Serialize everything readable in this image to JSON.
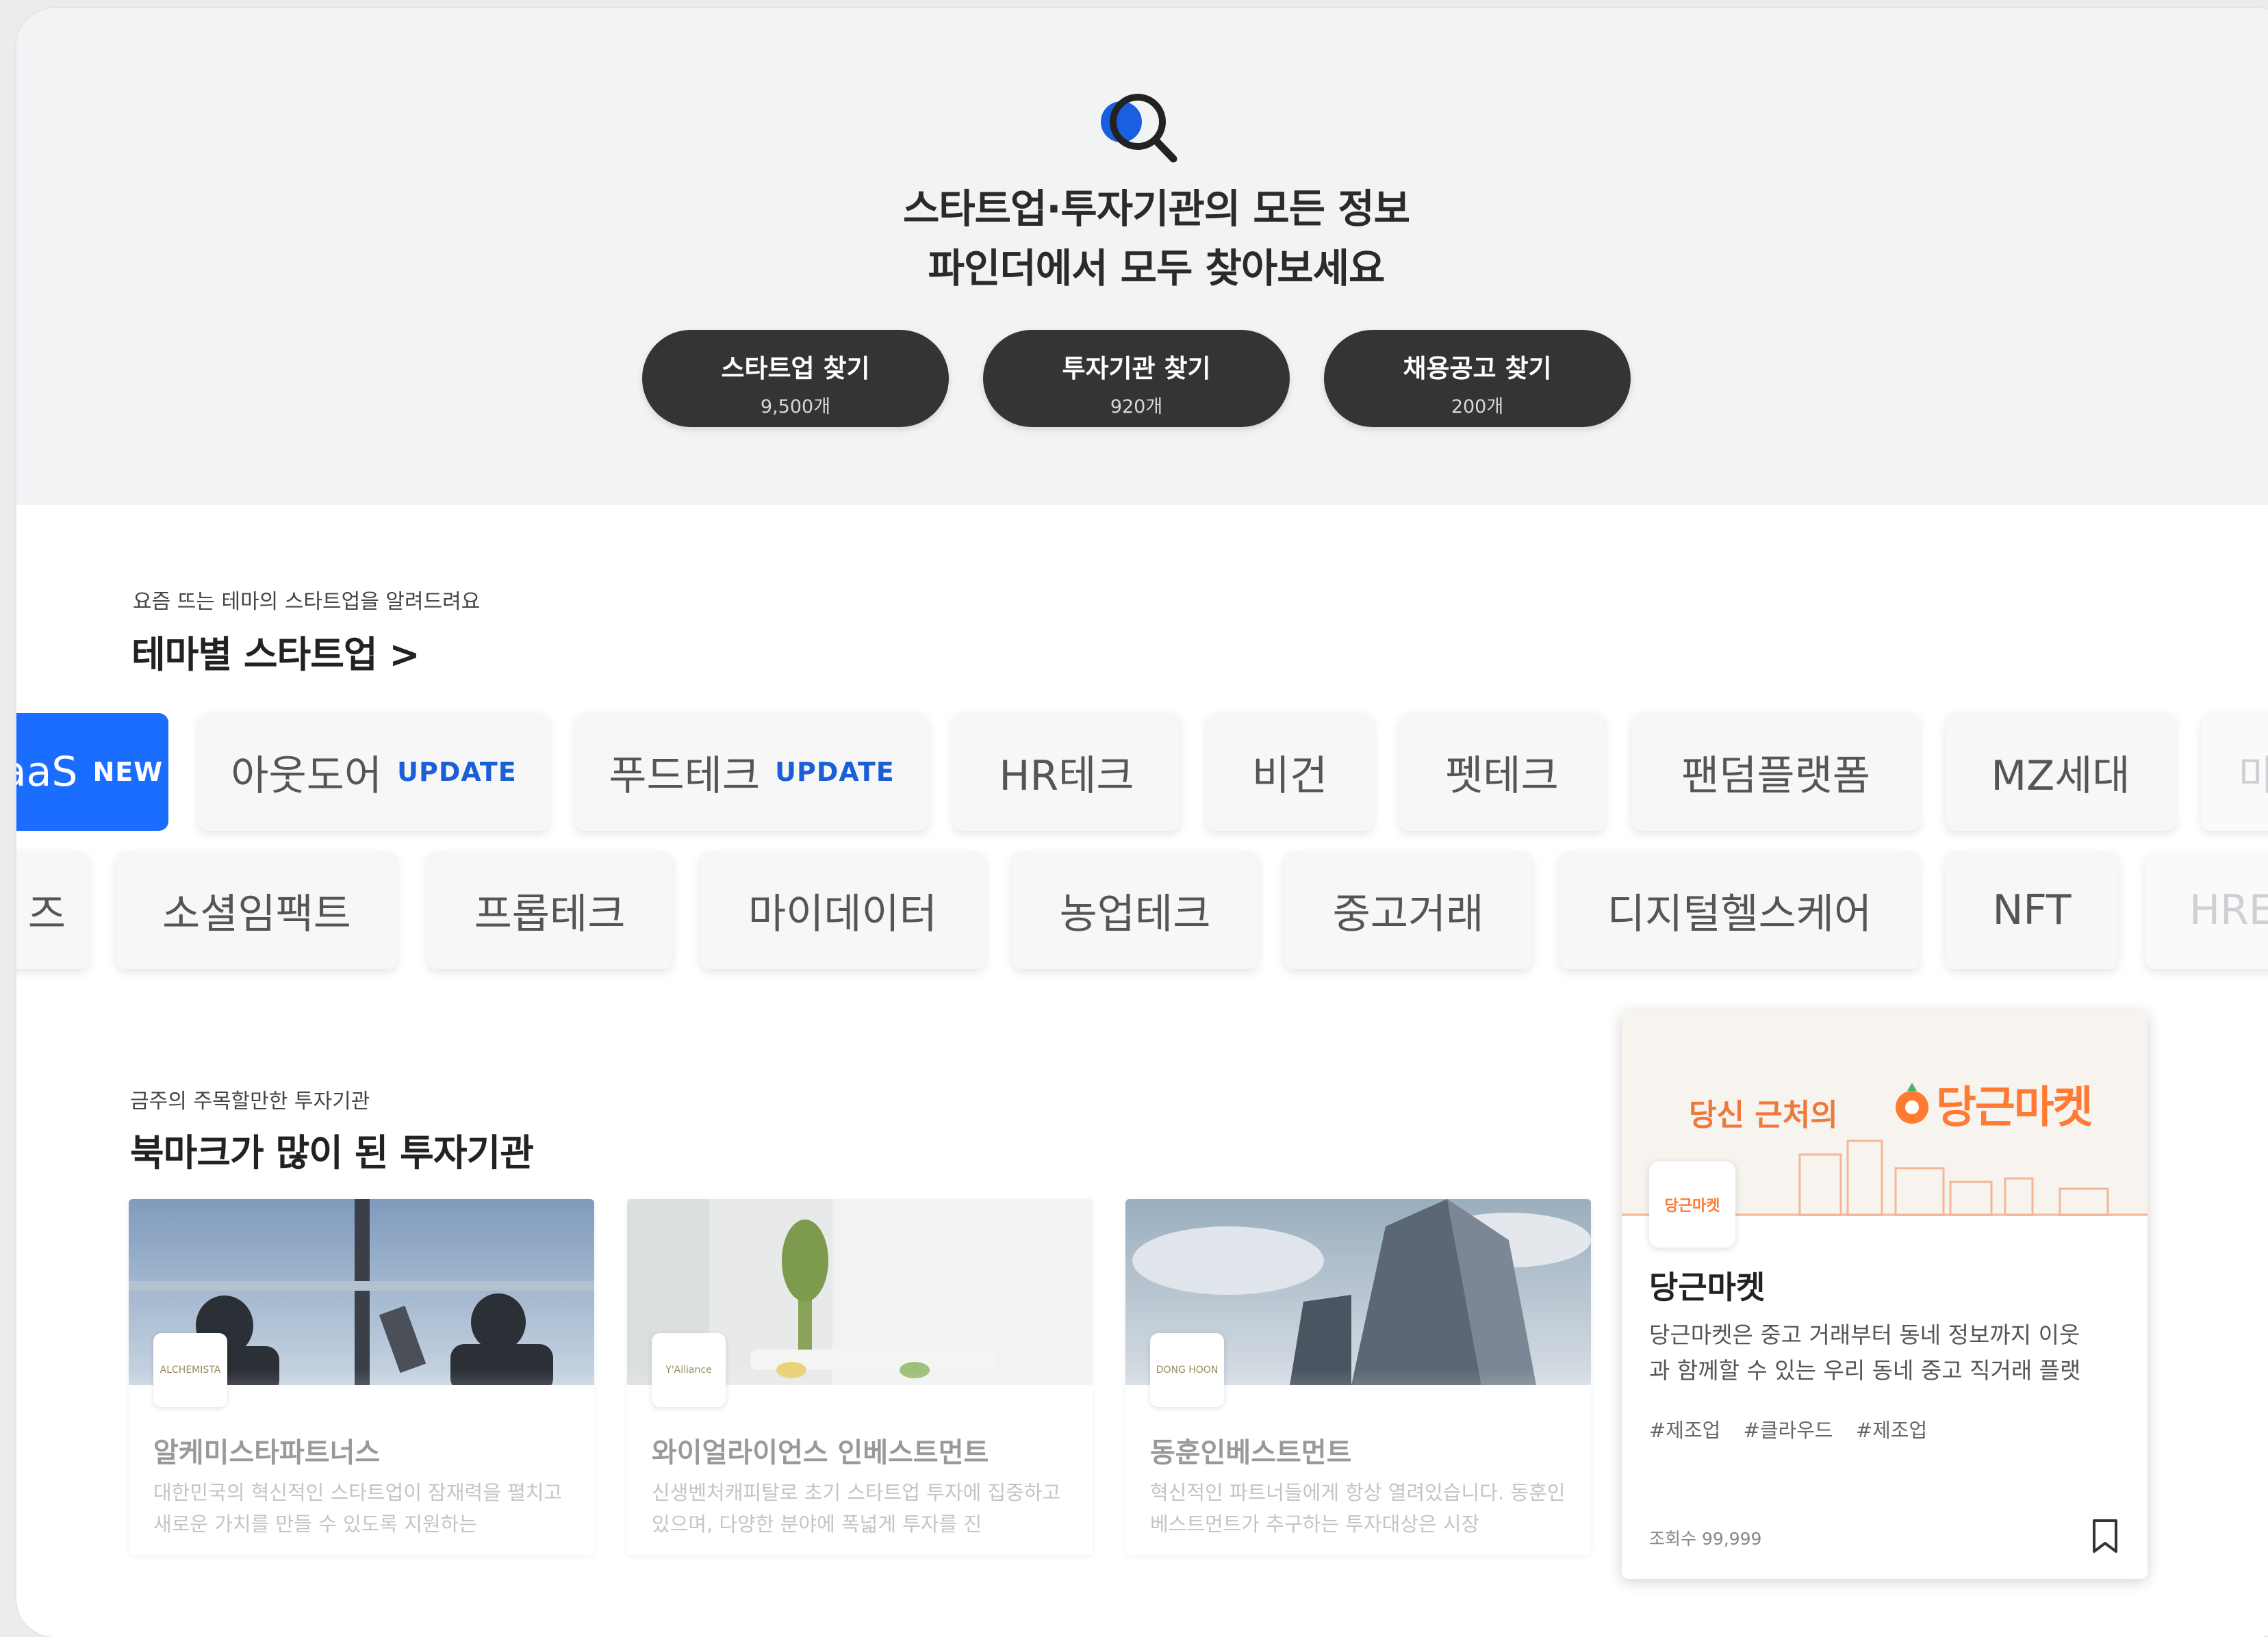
{
  "hero": {
    "title_line1": "스타트업·투자기관의 모든 정보",
    "title_line2": "파인더에서 모두 찾아보세요",
    "buttons": [
      {
        "label": "스타트업 찾기",
        "count": "9,500개"
      },
      {
        "label": "투자기관 찾기",
        "count": "920개"
      },
      {
        "label": "채용공고 찾기",
        "count": "200개"
      }
    ]
  },
  "theme_section": {
    "subtitle": "요즘 뜨는 테마의 스타트업을 알려드려요",
    "title": "테마별 스타트업 >",
    "row1": [
      {
        "label": "aaS",
        "badge": "NEW"
      },
      {
        "label": "아웃도어",
        "badge": "UPDATE"
      },
      {
        "label": "푸드테크",
        "badge": "UPDATE"
      },
      {
        "label": "HR테크",
        "badge": ""
      },
      {
        "label": "비건",
        "badge": ""
      },
      {
        "label": "펫테크",
        "badge": ""
      },
      {
        "label": "팬덤플랫폼",
        "badge": ""
      },
      {
        "label": "MZ세대",
        "badge": ""
      },
      {
        "label": "마",
        "badge": ""
      }
    ],
    "row2": [
      {
        "label": "즈"
      },
      {
        "label": "소셜임팩트"
      },
      {
        "label": "프롭테크"
      },
      {
        "label": "마이데이터"
      },
      {
        "label": "농업테크"
      },
      {
        "label": "중고거래"
      },
      {
        "label": "디지털헬스케어"
      },
      {
        "label": "NFT"
      },
      {
        "label": "HRE"
      }
    ]
  },
  "investor_section": {
    "subtitle": "금주의 주목할만한 투자기관",
    "title": "북마크가 많이 된 투자기관",
    "cards": [
      {
        "name": "알케미스타파트너스",
        "logo_text": "ALCHEMISTA",
        "desc": "대한민국의 혁신적인 스타트업이 잠재력을 펼치고 새로운 가치를 만들 수 있도록 지원하는"
      },
      {
        "name": "와이얼라이언스 인베스트먼트",
        "logo_text": "Y'Alliance",
        "desc": "신생벤처캐피탈로 초기 스타트업 투자에 집중하고 있으며, 다양한 분야에 폭넓게 투자를 진"
      },
      {
        "name": "동훈인베스트먼트",
        "logo_text": "DONG HOON",
        "desc": "혁신적인 파트너들에게 항상 열려있습니다. 동훈인베스트먼트가 추구하는 투자대상은 시장"
      }
    ]
  },
  "featured": {
    "banner_tag": "당신 근처의",
    "banner_brand": "당근마켓",
    "logo_text": "당근마켓",
    "name": "당근마켓",
    "desc_line1": "당근마켓은 중고 거래부터 동네 정보까지 이웃",
    "desc_line2": "과 함께할 수 있는 우리 동네 중고 직거래 플랫",
    "tags": [
      "#제조업",
      "#클라우드",
      "#제조업"
    ],
    "views": "조회수 99,999",
    "accent": "#ff7a33"
  }
}
